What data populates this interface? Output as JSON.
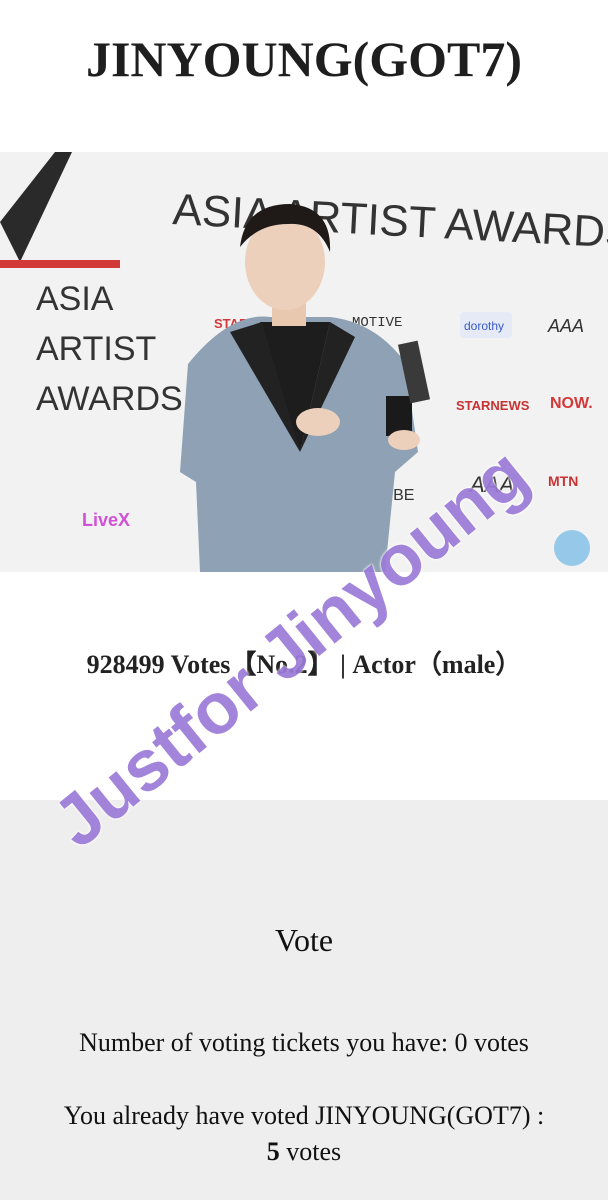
{
  "header": {
    "title": "JINYOUNG(GOT7)"
  },
  "photo": {
    "backdrop_title": "ASIA ARTIST AWARDS",
    "side_logo_lines": [
      "ASIA",
      "ARTIST",
      "AWARDS"
    ],
    "sponsors": [
      "MOTIVE",
      "dorothy",
      "STARNEWS",
      "NOW.",
      "VIBE",
      "MTN",
      "LiveX",
      "STAR"
    ]
  },
  "summary": {
    "votes_line": "928499 Votes【No.2】 | Actor（male）"
  },
  "vote": {
    "heading": "Vote",
    "tickets_line": "Number of voting tickets you have: 0 votes",
    "already_line_1": "You already have voted JINYOUNG(GOT7) :",
    "already_votes": "5",
    "already_line_2": " votes"
  },
  "watermark": {
    "text": "Justfor Jinyoung"
  },
  "colors": {
    "brand_red": "#d23a3a",
    "watermark": "#9b7ad8",
    "panel_bg": "#eeeeee"
  }
}
